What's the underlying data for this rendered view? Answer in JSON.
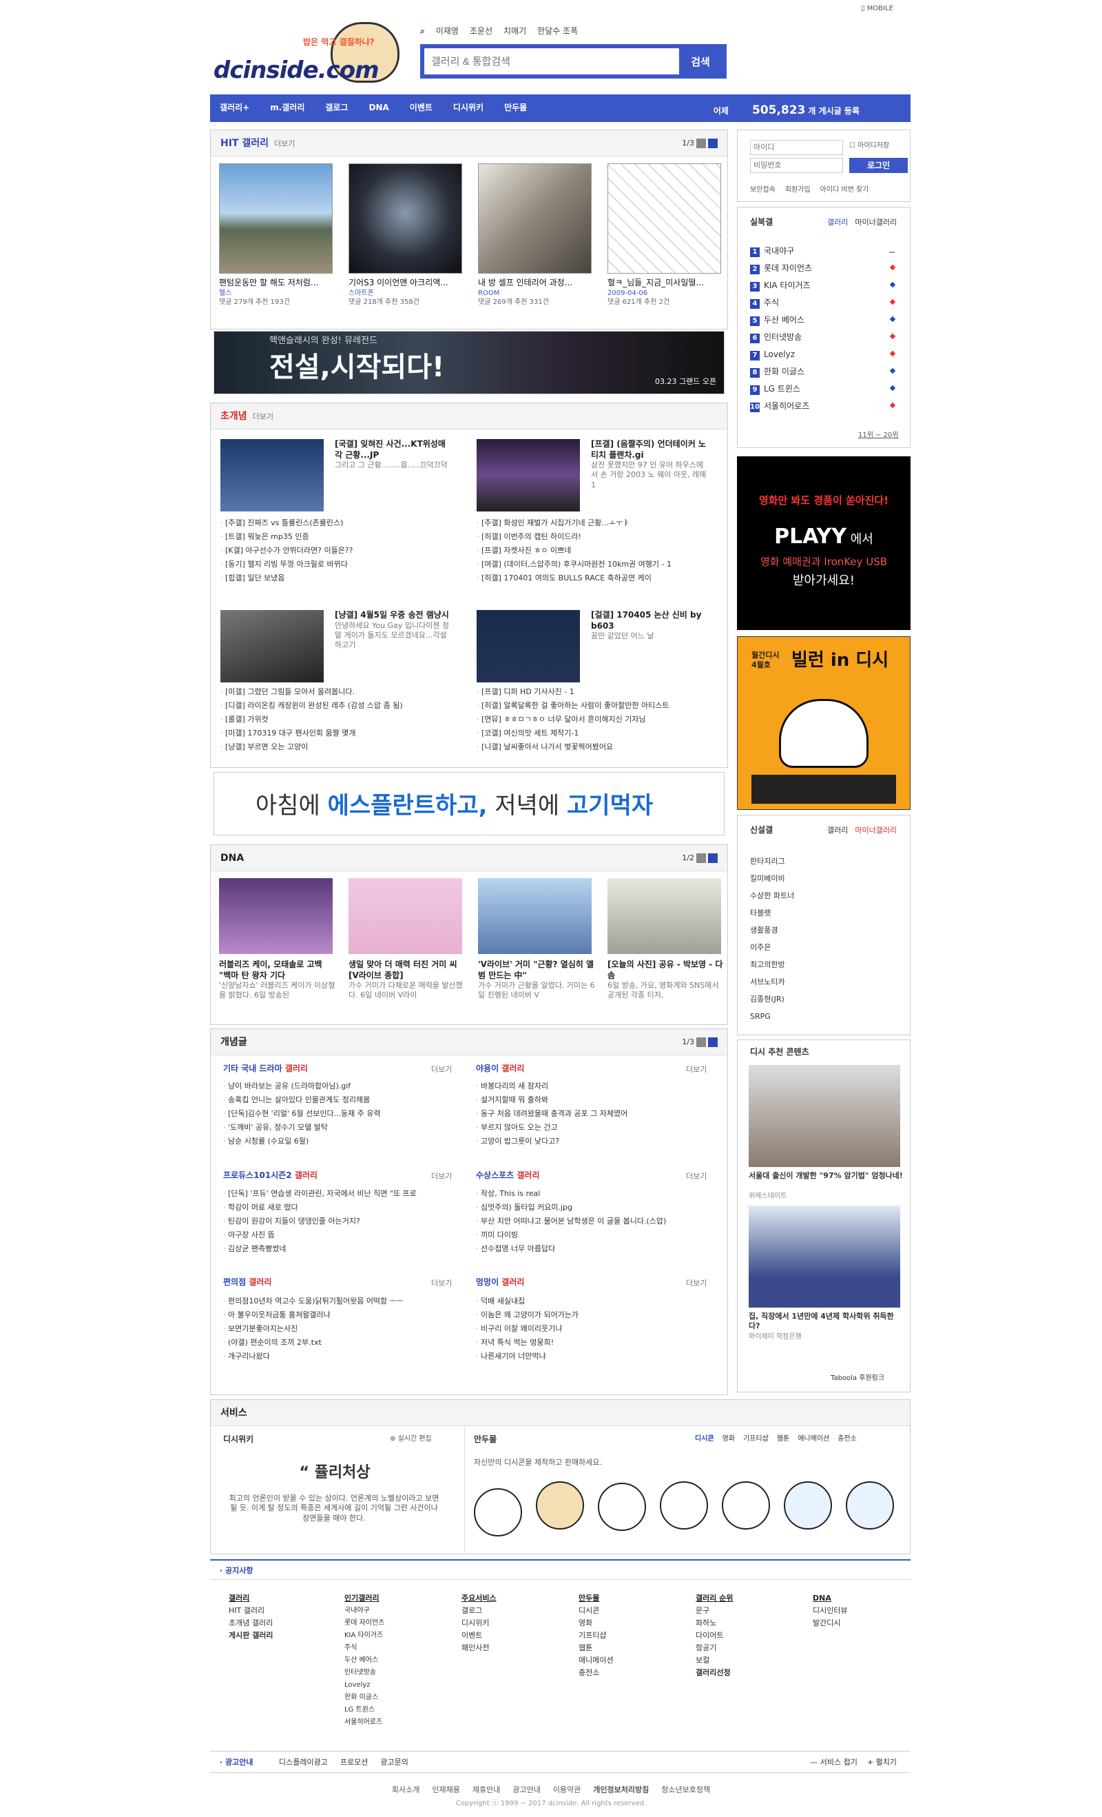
{
  "mobile": "MOBILE",
  "logo": {
    "text": "dcinside.com",
    "sub": "밥은 먹고 갤질하냐?"
  },
  "search": {
    "tabs": [
      "이재영",
      "조윤선",
      "치매기",
      "한달수 조폭"
    ],
    "placeholder": "갤러리 & 통합검색",
    "button": "검색"
  },
  "nav": {
    "items": [
      "갤러리+",
      "m.갤러리",
      "갤로그",
      "DNA",
      "이벤트",
      "디시위키",
      "만두몰"
    ],
    "visitor_label": "어제",
    "visitor_count": "505,823",
    "visitor_suffix": "개 게시글 등록"
  },
  "hit": {
    "title": "HIT 갤러리",
    "more": "더보기",
    "page": "1/3",
    "cards": [
      {
        "title": "팬텀운동만 할 해도 저처럼...",
        "gallery": "헬스",
        "stats": "댓글 279개  추천 193건"
      },
      {
        "title": "기어S3 이이언맨 아크리액...",
        "gallery": "스마트폰",
        "stats": "댓글 218개  추천 358건"
      },
      {
        "title": "내 방 셀프 인테리어 과정...",
        "gallery": "ROOM",
        "stats": "댓글 269개  추천 331건"
      },
      {
        "title": "혈ㅋ_님들_지금_미사일떨...",
        "gallery": "2009-04-06",
        "stats": "댓글 621개  추천 2건"
      }
    ]
  },
  "banner1": {
    "text": "전설,시작되다!",
    "sub": "핵앤슬래시의 완성! 뮤레전드",
    "date": "03.23 그랜드 오픈"
  },
  "gaenyeom": {
    "title": "초개념",
    "more": "더보기",
    "posts": [
      {
        "title": "[국갤] 잊혀진 사건...KT위성매각 근황...JP",
        "body": "그리고 그 근황........음.....끄덕끄덕"
      },
      {
        "title": "[프갤] (음짤주의) 언더테이커 노 티치 플랜차.gi",
        "body": "삼진 못했지만 97 인 유어 하우스에서 손 거랑 2003 노 웨이 아웃, 레매 1"
      },
      {
        "title": "[냥갤] 4월5일 우중 송전 램냥시",
        "body": "안녕하세요 You Gay 입니다이젠 정말 게이가 돌지도 모르겠네요...각설하고기"
      },
      {
        "title": "[걸갤] 170405 논산 신비 by b603",
        "body": "꿈만 같았던 어느 날"
      }
    ],
    "lists": [
      [
        "[주갤] 진짜즈 vs 틀률린스(존률린스)",
        "[트갤] 뭐늦은 mp35 인증",
        "[K갤] 야구선수가 안뛰더라면? 이들은??",
        "[동기] 헬지 리빙 뚜껑 아크릴로 바뀌다",
        "[힙갤] 일단 보냈음"
      ],
      [
        "[주갤] 화성인 재벌가 시집가기네 근황...ㅗㅜㅑ",
        "[히갤] 이번주의 캡틴 하이드라!",
        "[프갤] 자켓사진 ㅎㅇ 이쁘네",
        "[여갤] (데이터,스압주의) 후쿠시마원전 10km권 여행기 - 1",
        "[히갤] 170401 여의도 BULLS RACE 축하공연 케이"
      ],
      [
        "[미갤] 그렸던 그림들 모아서 올려봅니다.",
        "[디갤] 라이온킹 캐장윈이 완성된 레추 (감성 스압 좀 됨)",
        "[롤갤] 가위컷",
        "[미갤] 170319 대구 펜사인회 움짤 몇개",
        "[냥갤] 부르면 오는 고양이"
      ],
      [
        "[프갤] 디퍼 HD 기사사진 - 1",
        "[히갤] 알록달록한 걸 좋아하는 사람이 좋아할만한 아티스트",
        "[연뮤] ㅎㅎㅁㄱㅎㅇ 너무 달아서 흔이해지신 기자님",
        "[코갤] 여신의맛 세트 제작기-1",
        "[니갤] 날씨좋아서 나가서 벚꽃찍어봤어요"
      ]
    ]
  },
  "banner2": {
    "text1": "아침에 ",
    "text2": "에스플란트하고,",
    "text3": " 저녁에 ",
    "text4": "고기먹자"
  },
  "dna": {
    "title": "DNA",
    "page": "1/2",
    "cards": [
      {
        "title": "러블리즈 케이, 모태솔로 고백 \"백마 탄 왕자 기다",
        "body": "'신양남자쇼' 러블리즈 케이가 이상형을 밝혔다. 6일 방송된"
      },
      {
        "title": "생일 맞아 더 매력 터진 거미 씨 [V라이브 종합]",
        "body": "가수 거미가 다채로운 매력을 발산했다. 6일 네이버 V라이"
      },
      {
        "title": "'V라이브' 거미 \"근황? 열심히 앨범 만드는 中\"",
        "body": "가수 거미가 근황을 알렸다. 거미는 6일 진행된 네이버 V"
      },
      {
        "title": "[오늘의 사진] 공유 - 박보영 - 다솜",
        "body": "6일 방송, 가요, 영화계와 SNS에서 공개된 각종 티저,"
      }
    ]
  },
  "gaenyeomgeul": {
    "title": "개념글",
    "page": "1/3",
    "more": "더보기",
    "groups": [
      {
        "name": "기타 국내 드라마",
        "suffix": " 갤러리",
        "items": [
          "냥이 바라보는 공유 (드라마합아님).gif",
          "송혹킵 언니는 살아있다 인물관계도 정리해봄",
          "[단독]김수현 '리얼' 6월 선보인다...둥재 주 유력",
          "'도깨비' 공유, 정수기 모델 발탁",
          "남순 시청률 (수요일 6월)"
        ]
      },
      {
        "name": "야용이",
        "suffix": " 갤러리",
        "items": [
          "바봉다리의 새 잠자리",
          "설거지할때 뭐 출하봐",
          "동구 처음 데려왔을때 충격과 공포 그 자체였어",
          "부르지 않아도 오는 간고",
          "고양이 밥그릇이 낮다고?"
        ]
      },
      {
        "name": "프로듀스101시즌2",
        "suffix": " 갤러리",
        "items": [
          "[단독] '프듀' 연습생 라이관린, 자국에서 비난 직면 \"또 프로",
          "학강이 머료 새로 떴다",
          "틴강이 원강이 지들이 댕댕인줄 아는거지?",
          "야구장 사진 뜸",
          "김상균 팬측빵썼네"
        ]
      },
      {
        "name": "수상스포츠",
        "suffix": " 갤러리",
        "items": [
          "작상, This is real",
          "심멋주의) 돌타입 커요미.jpg",
          "부산 치안 어떠냐고 물어본 남학생은 이 글을 봅니다.(스압)",
          "끼미 다이빙",
          "선수접영 너무 아름답다"
        ]
      },
      {
        "name": "편의점",
        "suffix": " 갤러리",
        "items": [
          "편의점10년차 역고수 도움)닭튀기튈어왓음 어떡함 ㅡㅡ",
          "아 불우이웃저금통 훔쳐왈갤러냐",
          "보면기분좋아지는사진",
          "(야갤) 편순이의 조끼 2부.txt",
          "개구리나왔다"
        ]
      },
      {
        "name": "멍멍이",
        "suffix": " 갤러리",
        "items": [
          "덕배 새실내집",
          "이놈은 왜 고양이가 되어가는가",
          "비구리 이잘 왜이리웃기냐",
          "저녁 특식 먹는 멍뭉희!",
          "나른새기야 너만먹냐"
        ]
      }
    ]
  },
  "service": {
    "title": "서비스",
    "wiki": {
      "title": "디시위키",
      "link": "실시간 편집",
      "word": "퓰리처상",
      "desc": "최고의 언론인이 받을 수 있는 상이다. 언론계의 노벨상이라고 보면 될 듯. 이게 탈 정도의 특종은 세계사에 길이 기억될 그런 사건이나 장면들을 매야 한다."
    },
    "mall": {
      "title": "만두몰",
      "tabs": [
        "디시콘",
        "영화",
        "기프티샵",
        "웹툰",
        "애니메이션",
        "충전소"
      ],
      "desc": "자신만의 디시콘을 제작하고 판매하세요."
    }
  },
  "notice": "공지사항",
  "sitemap": [
    {
      "head": "갤러리",
      "items": [
        "HIT 갤러리",
        "초개념 갤러리",
        "게시판 갤러리"
      ]
    },
    {
      "head": "인기갤러리",
      "items": [
        "국내야구",
        "롯데 자이언츠",
        "KIA 타이거즈",
        "주식",
        "두산 베어스",
        "인터넷방송",
        "Lovelyz",
        "한화 이글스",
        "LG 트윈스",
        "서울히어로즈"
      ]
    },
    {
      "head": "주요서비스",
      "items": [
        "갤로그",
        "디시위키",
        "이벤트",
        "패인사전"
      ]
    },
    {
      "head": "만두몰",
      "items": [
        "디시콘",
        "영화",
        "기프티샵",
        "웹툰",
        "애니메이션",
        "충전소"
      ]
    },
    {
      "head": "갤러리 순위",
      "items": [
        "문구",
        "파하노",
        "다이어트",
        "항공기",
        "보컬",
        "갤러리선정"
      ]
    },
    {
      "head": "DNA",
      "items": [
        "디시인터뷰",
        "발간디시"
      ]
    }
  ],
  "adlinks": {
    "title": "광고안내",
    "items": [
      "디스플레이광고",
      "프로모션",
      "광고문의"
    ],
    "right": [
      "서비스 접기",
      "펼치기"
    ]
  },
  "footer": {
    "links": [
      "회사소개",
      "인재채용",
      "제휴안내",
      "광고안내",
      "이용약관",
      "개인정보처리방침",
      "청소년보호정책"
    ],
    "copy": "Copyright ⓒ 1999 ~ 2017 dcinside. All rights reserved."
  },
  "sidebar": {
    "login": {
      "id_placeholder": "아이디",
      "pw_placeholder": "비밀번호",
      "save": "아이디저장",
      "button": "로그인",
      "links": [
        "보안접속",
        "회원가입",
        "아이디 비번 찾기"
      ]
    },
    "realtime": {
      "title": "실북갤",
      "tabs": [
        "갤러리",
        "마이너갤러리"
      ],
      "items": [
        "국내야구",
        "롯데 자이언츠",
        "KIA 타이거즈",
        "주식",
        "두산 베어스",
        "인터넷방송",
        "Lovelyz",
        "한화 이글스",
        "LG 트윈스",
        "서울히어로즈"
      ],
      "more": "11위 ~ 20위"
    },
    "ad1": {
      "l1": "영화만 봐도 경품이 쏟아진다!",
      "l2": "PLAYY",
      "l3": "에서",
      "l4": "영화 예매권과 IronKey USB",
      "l5": "받아가세요!"
    },
    "ad2": {
      "l1": "월간디시 4월호",
      "l2": "빌런 in 디시"
    },
    "newgal": {
      "title": "신설갤",
      "tabs": [
        "갤러리",
        "마이너갤러리"
      ],
      "items": [
        "판타지리그",
        "킬미베이비",
        "수상한 파트너",
        "타블렛",
        "생활풍경",
        "이주은",
        "최고의한방",
        "서브노티카",
        "김종현(JR)",
        "SRPG"
      ]
    },
    "recommend": {
      "title": "디시 추천 콘텐츠",
      "items": [
        {
          "title": "서울대 출신이 개발한 \"97% 암기법\" 엄청나네!",
          "source": "위메스테이트"
        },
        {
          "title": "집, 직장에서 1년만에 4년제 학사학위 취득한다?",
          "source": "와이제이 학점은행"
        }
      ],
      "taboola": "Taboola 후원링크"
    }
  }
}
